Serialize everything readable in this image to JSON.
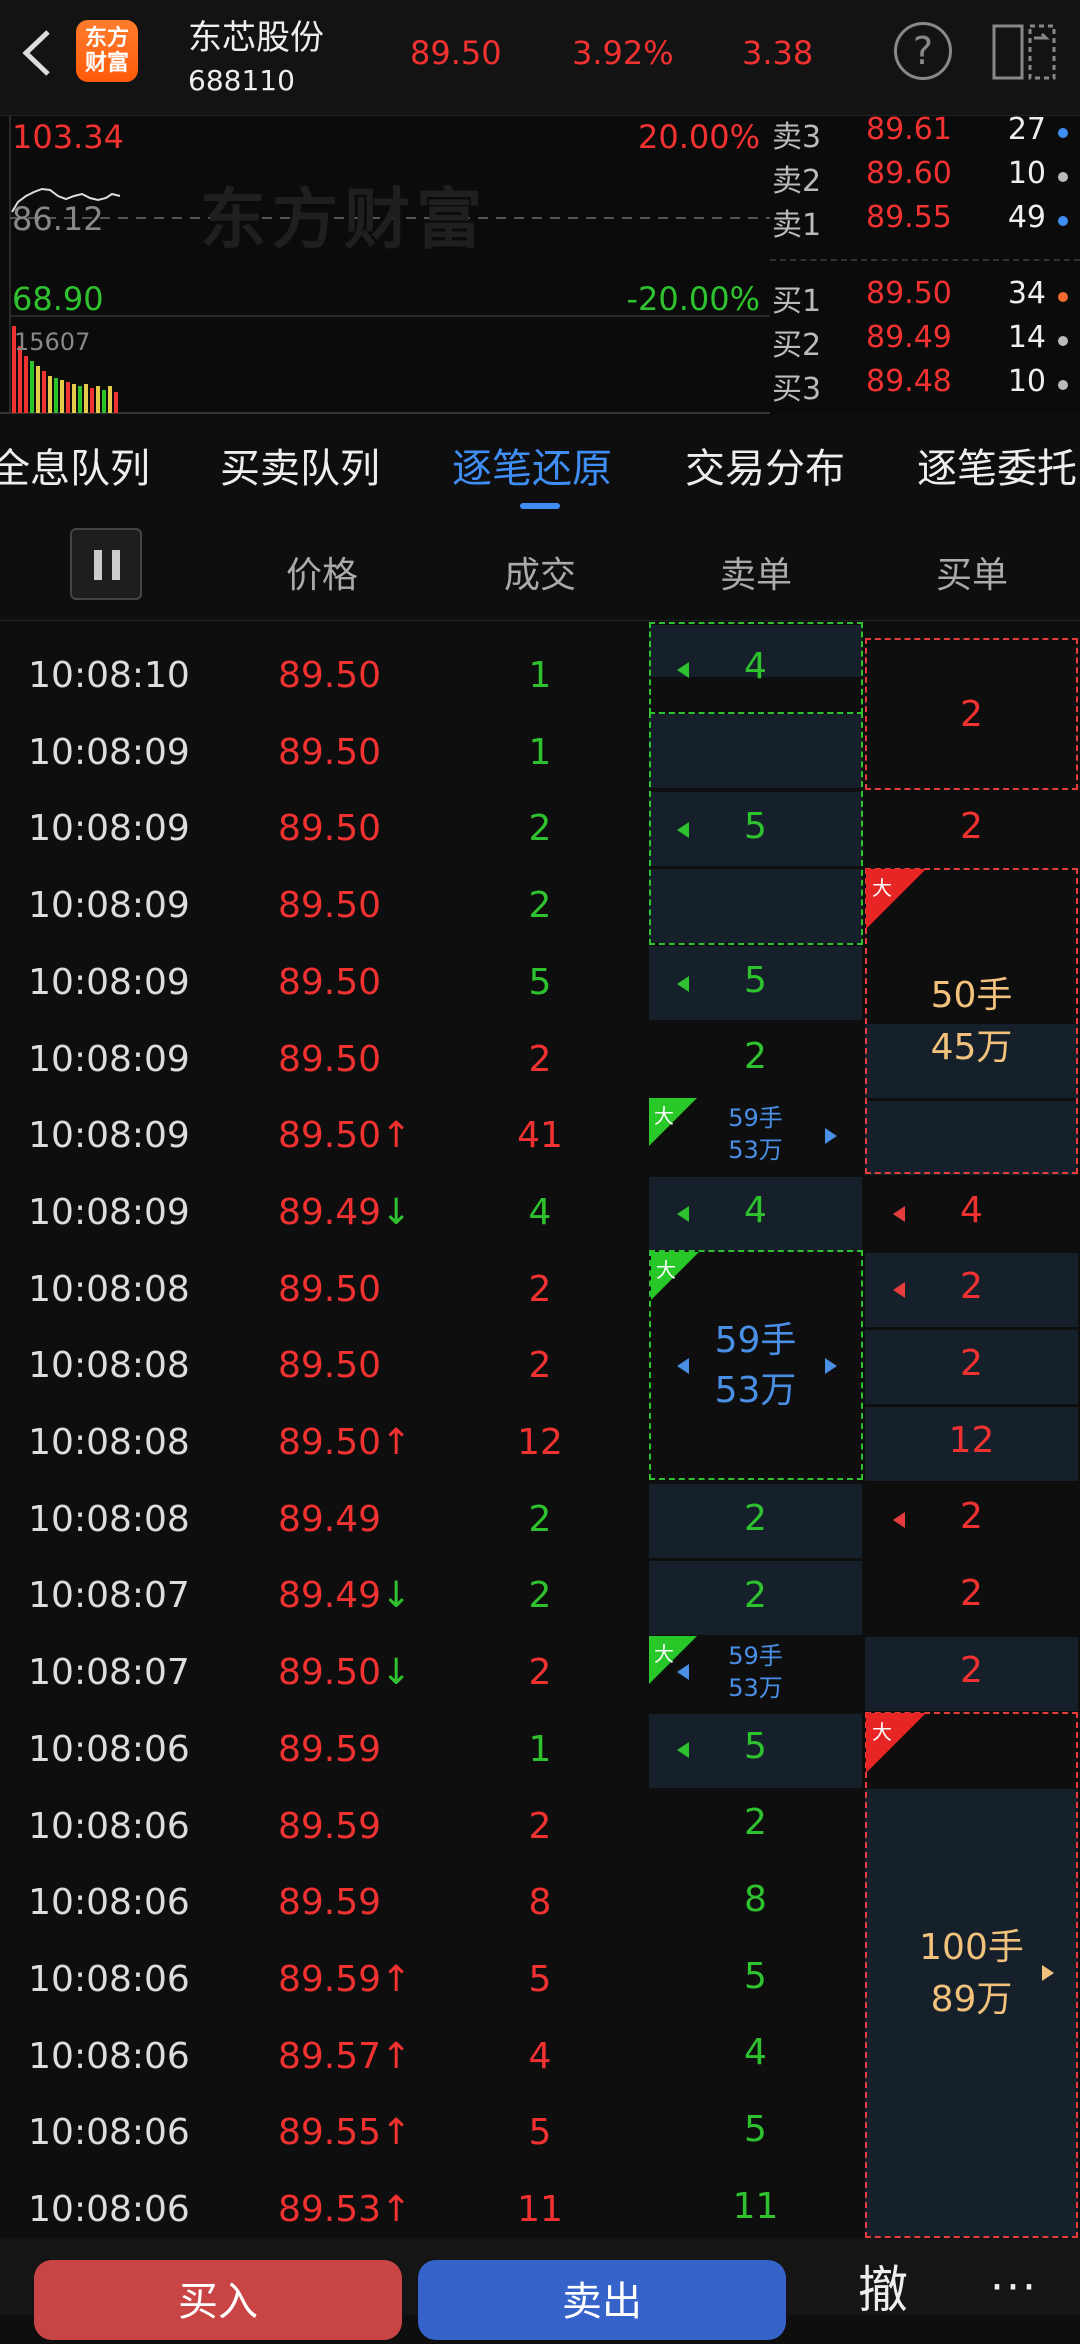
{
  "header": {
    "logo_line1": "东方",
    "logo_line2": "财富",
    "stock_name": "东芯股份",
    "stock_code": "688110",
    "price": "89.50",
    "change_pct": "3.92%",
    "change": "3.38",
    "help_symbol": "?"
  },
  "chart": {
    "high": "103.34",
    "high_pct": "20.00%",
    "prev_close": "86.12",
    "low": "68.90",
    "low_pct": "-20.00%",
    "volume": "15607",
    "watermark": "东方财富"
  },
  "orderbook": [
    {
      "label": "卖3",
      "price": "89.61",
      "vol": "27",
      "dot": "#3f8ef5"
    },
    {
      "label": "卖2",
      "price": "89.60",
      "vol": "10",
      "dot": "#bbbbbb"
    },
    {
      "label": "卖1",
      "price": "89.55",
      "vol": "49",
      "dot": "#3f8ef5"
    },
    {
      "label": "买1",
      "price": "89.50",
      "vol": "34",
      "dot": "#f26b2c"
    },
    {
      "label": "买2",
      "price": "89.49",
      "vol": "14",
      "dot": "#bbbbbb"
    },
    {
      "label": "买3",
      "price": "89.48",
      "vol": "10",
      "dot": "#bbbbbb"
    }
  ],
  "tabs": [
    "全息队列",
    "买卖队列",
    "逐笔还原",
    "交易分布",
    "逐笔委托"
  ],
  "columns": {
    "price": "价格",
    "volume": "成交",
    "sell": "卖单",
    "buy": "买单"
  },
  "trades": [
    {
      "time": "10:08:10",
      "price": "89.50",
      "arrow": "",
      "vol": "1",
      "vc": "green"
    },
    {
      "time": "10:08:09",
      "price": "89.50",
      "arrow": "",
      "vol": "1",
      "vc": "green"
    },
    {
      "time": "10:08:09",
      "price": "89.50",
      "arrow": "",
      "vol": "2",
      "vc": "green"
    },
    {
      "time": "10:08:09",
      "price": "89.50",
      "arrow": "",
      "vol": "2",
      "vc": "green"
    },
    {
      "time": "10:08:09",
      "price": "89.50",
      "arrow": "",
      "vol": "5",
      "vc": "green"
    },
    {
      "time": "10:08:09",
      "price": "89.50",
      "arrow": "",
      "vol": "2",
      "vc": "red"
    },
    {
      "time": "10:08:09",
      "price": "89.50",
      "arrow": "↑",
      "vol": "41",
      "vc": "red"
    },
    {
      "time": "10:08:09",
      "price": "89.49",
      "arrow": "↓",
      "vol": "4",
      "vc": "green"
    },
    {
      "time": "10:08:08",
      "price": "89.50",
      "arrow": "",
      "vol": "2",
      "vc": "red"
    },
    {
      "time": "10:08:08",
      "price": "89.50",
      "arrow": "",
      "vol": "2",
      "vc": "red"
    },
    {
      "time": "10:08:08",
      "price": "89.50",
      "arrow": "↑",
      "vol": "12",
      "vc": "red"
    },
    {
      "time": "10:08:08",
      "price": "89.49",
      "arrow": "",
      "vol": "2",
      "vc": "green"
    },
    {
      "time": "10:08:07",
      "price": "89.49",
      "arrow": "↓",
      "vol": "2",
      "vc": "green"
    },
    {
      "time": "10:08:07",
      "price": "89.50",
      "arrow": "↓",
      "vol": "2",
      "vc": "red"
    },
    {
      "time": "10:08:06",
      "price": "89.59",
      "arrow": "",
      "vol": "1",
      "vc": "green"
    },
    {
      "time": "10:08:06",
      "price": "89.59",
      "arrow": "",
      "vol": "2",
      "vc": "red"
    },
    {
      "time": "10:08:06",
      "price": "89.59",
      "arrow": "",
      "vol": "8",
      "vc": "red"
    },
    {
      "time": "10:08:06",
      "price": "89.59",
      "arrow": "↑",
      "vol": "5",
      "vc": "red"
    },
    {
      "time": "10:08:06",
      "price": "89.57",
      "arrow": "↑",
      "vol": "4",
      "vc": "red"
    },
    {
      "time": "10:08:06",
      "price": "89.55",
      "arrow": "↑",
      "vol": "5",
      "vc": "red"
    },
    {
      "time": "10:08:06",
      "price": "89.53",
      "arrow": "↑",
      "vol": "11",
      "vc": "red"
    }
  ],
  "sell_cells": [
    "4",
    "5",
    "5",
    "2",
    "59手",
    "53万",
    "4",
    "59手",
    "53万",
    "2",
    "2",
    "59手",
    "53万",
    "5",
    "2",
    "8",
    "5",
    "4",
    "5",
    "11"
  ],
  "buy_cells": [
    "2",
    "2",
    "50手",
    "45万",
    "4",
    "2",
    "2",
    "12",
    "2",
    "2",
    "2",
    "100手",
    "89万"
  ],
  "big_label": "大",
  "footer": {
    "buy": "买入",
    "sell": "卖出",
    "cancel": "撤",
    "more": "···"
  }
}
